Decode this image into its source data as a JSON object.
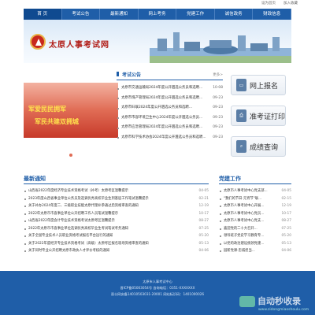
{
  "toplinks": [
    "设为首页",
    "加入收藏"
  ],
  "nav": [
    "首 页",
    "考试公告",
    "最新通知",
    "网上考务",
    "党建工作",
    "诚信政务",
    "财政信息"
  ],
  "site_title": "太原人事考试网",
  "slideshow": {
    "line1": "军爱民民拥军",
    "line2": "军民共建双拥城"
  },
  "news": {
    "title": "考试公告",
    "more": "更多>",
    "items": [
      {
        "t": "太原市交通运输局2024年度公开遴选公务员和选聘...",
        "d": "10-08"
      },
      {
        "t": "太原市煤产管理局2024年度公开遴选公务员和选聘...",
        "d": "09-23"
      },
      {
        "t": "太原市妇联2024年度公开遴选公务员和选聘...",
        "d": "09-23"
      },
      {
        "t": "太原市市容环境卫生中心2024年度公开遴选公务员...",
        "d": "09-23"
      },
      {
        "t": "太原市应急管理局2024年度公开遴选公务员和选聘...",
        "d": "09-23"
      },
      {
        "t": "太原市科学技术协会2024年度公开遴选公务员和选聘...",
        "d": "09-23"
      }
    ]
  },
  "quick": [
    {
      "label": "网上报名",
      "icon": "computer-icon"
    },
    {
      "label": "准考证打印",
      "icon": "printer-icon"
    },
    {
      "label": "成绩查询",
      "icon": "search-icon"
    }
  ],
  "latest": {
    "title": "最新通知",
    "more": "更多>",
    "items": [
      {
        "t": "山西省2022年度经济专业技术资格考试（补考）太原考区温馨提示",
        "d": "04-05"
      },
      {
        "t": "2023年度山西省事业单位公务员及选调优秀高校毕业生到基层工作笔试温馨提示",
        "d": "02-21"
      },
      {
        "t": "关于补办2024年度二、三级职业技能太原代理补参通过后资格审查的通知",
        "d": "12-19"
      },
      {
        "t": "2022年太原市市直事业单位公开招聘工作人员笔试温馨提示",
        "d": "10-17"
      },
      {
        "t": "山西省2022年度会计专业技术资格考试太原考区温馨提示",
        "d": "08-27"
      },
      {
        "t": "2022年太原市市直事业单位选调优秀高校毕业生考试笔试考务通知",
        "d": "07-25"
      },
      {
        "t": "关于全国专业技术人员职业资格考试报名平台运行的通知",
        "d": "05-20"
      },
      {
        "t": "关于2022年度经济专业技术资格考试（高级）太原考区报名现场资格审查的通知",
        "d": "05-13"
      },
      {
        "t": "关于同时专业公开招聘太原市政执人才评价考核的通知",
        "d": "04-06"
      }
    ]
  },
  "party": {
    "title": "党建工作",
    "more": "更多>",
    "items": [
      {
        "t": "太原市人事考试中心党支部...",
        "d": "04-05"
      },
      {
        "t": "\"我们的节日·元宵节\"联...",
        "d": "02-15"
      },
      {
        "t": "太原市人事考试中心开展...",
        "d": "12-19"
      },
      {
        "t": "太原市人事考试中心党员...",
        "d": "10-17"
      },
      {
        "t": "太原市人事考试中心党支...",
        "d": "08-27"
      },
      {
        "t": "喜迎党的二十大召开...",
        "d": "07-25"
      },
      {
        "t": "领导班子党史学习教育专...",
        "d": "05-20"
      },
      {
        "t": "以党的政治建设统领党建...",
        "d": "05-13"
      },
      {
        "t": "园新党课·忠诚担当...",
        "d": "04-06"
      }
    ]
  },
  "footer": {
    "lines": [
      "太原市人事考试中心",
      "晋ICP备05003054号  咨询电话：0351-XXXXXXX",
      "晋公网安备14010503031-20001  网站标识码：1401000026"
    ]
  },
  "watermark": {
    "text": "自动秒收录",
    "url": "www.zidongmiaoshoulu.com"
  }
}
